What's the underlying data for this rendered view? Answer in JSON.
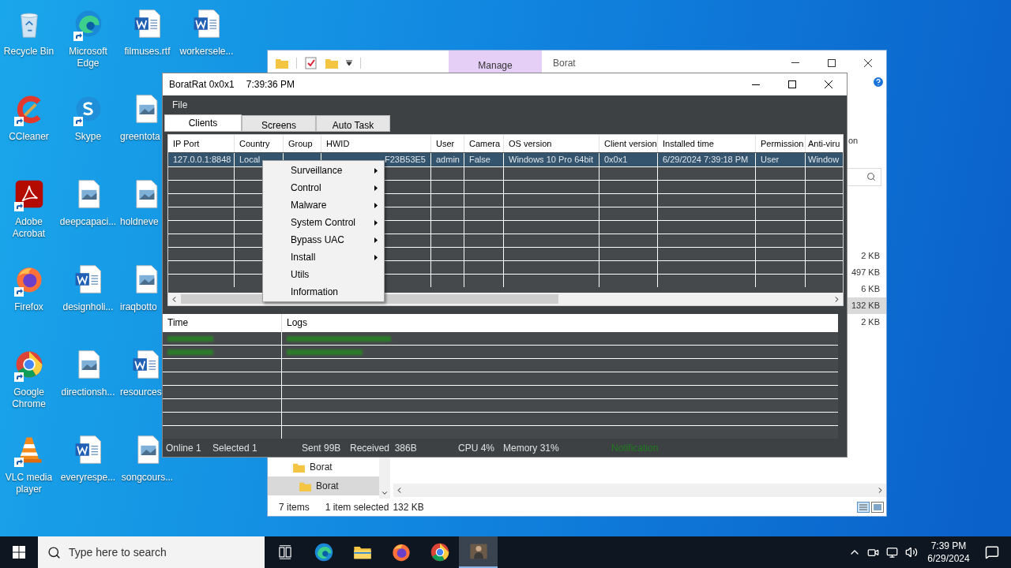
{
  "desktop": {
    "icons": [
      {
        "label": "Recycle Bin",
        "kind": "recycle",
        "shortcut": false,
        "cut": false
      },
      {
        "label": "CCleaner",
        "kind": "ccleaner",
        "shortcut": true,
        "cut": false
      },
      {
        "label": "Adobe Acrobat",
        "kind": "acrobat",
        "shortcut": true,
        "cut": false
      },
      {
        "label": "Firefox",
        "kind": "firefox",
        "shortcut": true,
        "cut": false
      },
      {
        "label": "Google Chrome",
        "kind": "chrome",
        "shortcut": true,
        "cut": false
      },
      {
        "label": "VLC media player",
        "kind": "vlc",
        "shortcut": true,
        "cut": false
      },
      {
        "label": "Microsoft Edge",
        "kind": "edge",
        "shortcut": true,
        "cut": false
      },
      {
        "label": "Skype",
        "kind": "skype",
        "shortcut": true,
        "cut": false
      },
      {
        "label": "deepcapaci...",
        "kind": "image",
        "shortcut": false,
        "cut": false
      },
      {
        "label": "designholi...",
        "kind": "word",
        "shortcut": false,
        "cut": false
      },
      {
        "label": "directionsh...",
        "kind": "image",
        "shortcut": false,
        "cut": false
      },
      {
        "label": "everyrespe...",
        "kind": "word",
        "shortcut": false,
        "cut": false
      },
      {
        "label": "filmuses.rtf",
        "kind": "word",
        "shortcut": false,
        "cut": false
      },
      {
        "label": "greentota",
        "kind": "image",
        "shortcut": false,
        "cut": true
      },
      {
        "label": "holdneve",
        "kind": "image",
        "shortcut": false,
        "cut": true
      },
      {
        "label": "iraqbotto",
        "kind": "image",
        "shortcut": false,
        "cut": true
      },
      {
        "label": "resources",
        "kind": "word",
        "shortcut": false,
        "cut": true
      },
      {
        "label": "songcours...",
        "kind": "image",
        "shortcut": false,
        "cut": false
      },
      {
        "label": "workersele...",
        "kind": "word",
        "shortcut": false,
        "cut": false
      }
    ]
  },
  "explorer": {
    "ribbon_tab": "Manage",
    "title": "Borat",
    "partial_text": "on",
    "sizes": [
      {
        "text": "2 KB",
        "selected": false
      },
      {
        "text": "497 KB",
        "selected": false
      },
      {
        "text": "6 KB",
        "selected": false
      },
      {
        "text": "132 KB",
        "selected": true
      },
      {
        "text": "2 KB",
        "selected": false
      }
    ],
    "nav_items": [
      {
        "label": "Borat",
        "selected": false
      },
      {
        "label": "Borat",
        "selected": true
      }
    ],
    "status": [
      "7 items",
      "1 item selected",
      "132 KB"
    ]
  },
  "rat": {
    "title": "BoratRat 0x0x1",
    "time": "7:39:36 PM",
    "menu": [
      "File"
    ],
    "tabs": [
      {
        "label": "Clients",
        "selected": true
      },
      {
        "label": "Screens",
        "selected": false
      },
      {
        "label": "Auto Task",
        "selected": false
      }
    ],
    "clients": {
      "columns": [
        "IP Port",
        "Country",
        "Group",
        "HWID",
        "User",
        "Camera",
        "OS version",
        "Client version",
        "Installed time",
        "Permission",
        "Anti-viru"
      ],
      "rows": [
        {
          "selected": true,
          "cells": [
            "127.0.0.1:8848",
            "Local",
            null,
            "F23B53E5",
            "admin",
            "False",
            "Windows 10 Pro 64bit",
            "0x0x1",
            "6/29/2024 7:39:18 PM",
            "User",
            "Window"
          ]
        }
      ]
    },
    "context_menu": [
      {
        "label": "Surveillance",
        "submenu": true
      },
      {
        "label": "Control",
        "submenu": true
      },
      {
        "label": "Malware",
        "submenu": true
      },
      {
        "label": "System Control",
        "submenu": true
      },
      {
        "label": "Bypass UAC",
        "submenu": true
      },
      {
        "label": "Install",
        "submenu": true
      },
      {
        "label": "Utils",
        "submenu": false
      },
      {
        "label": "Information",
        "submenu": false
      }
    ],
    "logs": {
      "columns": [
        "Time",
        "Logs"
      ]
    },
    "status_bar": {
      "items": [
        "Online 1",
        "Selected 1",
        "Sent 99B",
        "Received  386B",
        "CPU 4%",
        "Memory 31%"
      ],
      "notification": "Notification"
    }
  },
  "taskbar": {
    "search_placeholder": "Type here to search",
    "apps": [
      {
        "kind": "taskview",
        "active": false
      },
      {
        "kind": "edge",
        "active": false
      },
      {
        "kind": "explorer",
        "active": false
      },
      {
        "kind": "firefox",
        "active": false
      },
      {
        "kind": "chrome",
        "active": false
      },
      {
        "kind": "rat",
        "active": true
      }
    ],
    "clock": {
      "time": "7:39 PM",
      "date": "6/29/2024"
    }
  }
}
